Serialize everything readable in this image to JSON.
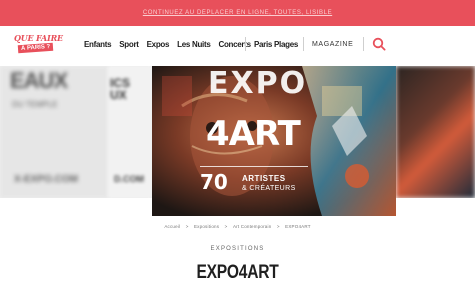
{
  "topbar": {
    "text": "Continuez au déplacer en ligne, toutes, lisible"
  },
  "logo": {
    "line1": "QUE FAIRE",
    "line2": "À PARIS ?"
  },
  "nav": {
    "items": [
      {
        "label": "Enfants"
      },
      {
        "label": "Sport"
      },
      {
        "label": "Expos"
      },
      {
        "label": "Les Nuits"
      },
      {
        "label": "Concerts"
      }
    ],
    "paris_plages": "Paris Plages",
    "magazine": "MAGAZINE",
    "search_icon": "search-icon"
  },
  "hero": {
    "left_big": "EAUX",
    "left_small": "DU TEMPLE",
    "left_url": "X-EXPO.COM",
    "mid_line1": "ICS",
    "mid_line2": "UX",
    "mid_url": "D.COM",
    "poster": {
      "expo": "EXPO",
      "fourart": "4ART",
      "seventy": "70",
      "artistes": "ARTISTES",
      "createurs": "& CRÉATEURS"
    }
  },
  "breadcrumb": {
    "items": [
      "Accueil",
      ">",
      "Expositions",
      ">",
      "Art Contemporain",
      ">",
      "EXPO4ART"
    ]
  },
  "category": "EXPOSITIONS",
  "title": "EXPO4ART",
  "colors": {
    "accent": "#e8505b"
  }
}
